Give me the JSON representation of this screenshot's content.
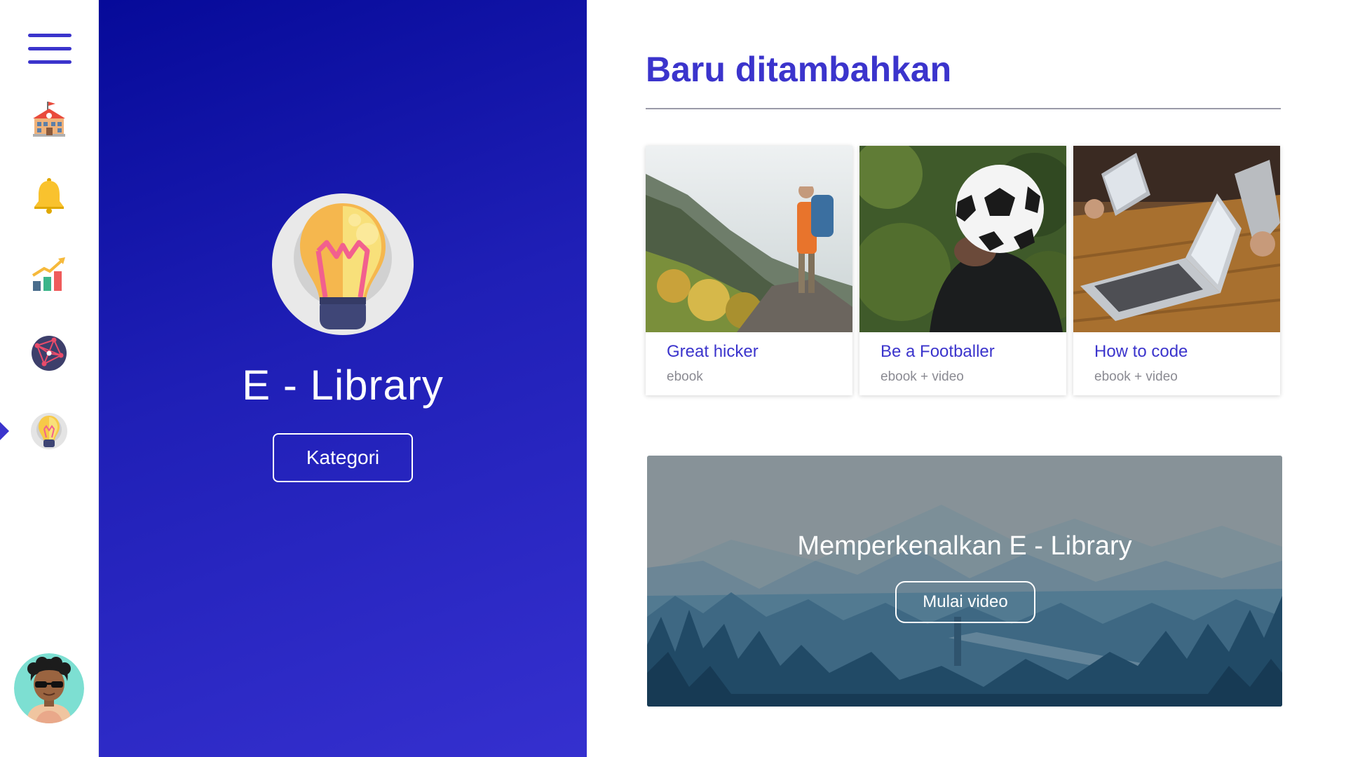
{
  "sidebar": {
    "menu_icon": "hamburger-menu-icon",
    "items": [
      {
        "icon": "school-icon",
        "active": false
      },
      {
        "icon": "bell-icon",
        "active": false
      },
      {
        "icon": "growth-chart-icon",
        "active": false
      },
      {
        "icon": "network-globe-icon",
        "active": false
      },
      {
        "icon": "lightbulb-icon",
        "active": true
      }
    ],
    "avatar_icon": "user-avatar",
    "accent": "#3b34cc"
  },
  "hero": {
    "logo_icon": "lightbulb-icon",
    "title": "E - Library",
    "button_label": "Kategori",
    "gradient": [
      "#060a99",
      "#3530cf"
    ]
  },
  "main": {
    "section_title": "Baru ditambahkan",
    "cards": [
      {
        "title": "Great hicker",
        "subtitle": "ebook",
        "image": "hiker-on-mountain-photo"
      },
      {
        "title": "Be a Footballer",
        "subtitle": "ebook + video",
        "image": "football-in-hand-photo"
      },
      {
        "title": "How to code",
        "subtitle": "ebook + video",
        "image": "laptops-on-table-photo"
      }
    ],
    "promo": {
      "title": "Memperkenalkan E - Library",
      "button_label": "Mulai video",
      "image": "mountain-forest-landscape"
    }
  },
  "colors": {
    "accent": "#3b34cc",
    "muted_text": "#8a8a92"
  }
}
